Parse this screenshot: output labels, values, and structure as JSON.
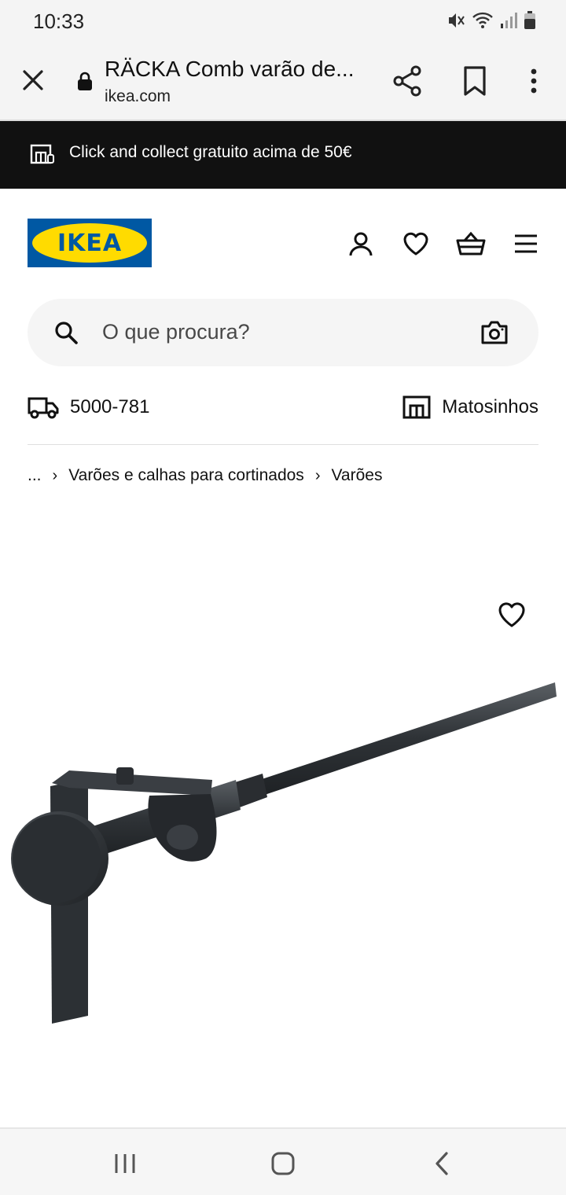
{
  "status_bar": {
    "time": "10:33"
  },
  "browser": {
    "page_title": "RÄCKA Comb varão de...",
    "domain": "ikea.com"
  },
  "promo": {
    "text": "Click and collect gratuito acima de 50€"
  },
  "header": {
    "logo_text": "IKEA"
  },
  "search": {
    "placeholder": "O que procura?"
  },
  "location": {
    "postal_code": "5000-781",
    "store": "Matosinhos"
  },
  "breadcrumb": {
    "ellipsis": "...",
    "separator": "›",
    "items": [
      "Varões e calhas para cortinados",
      "Varões"
    ]
  },
  "colors": {
    "ikea_blue": "#0058a3",
    "ikea_yellow": "#ffdb00",
    "promo_bg": "#111111"
  },
  "icons": [
    "close-icon",
    "lock-icon",
    "share-icon",
    "bookmark-icon",
    "more-icon",
    "store-icon",
    "user-icon",
    "heart-icon",
    "basket-icon",
    "hamburger-icon",
    "search-icon",
    "camera-icon",
    "truck-icon",
    "recents-icon",
    "home-icon",
    "back-icon"
  ]
}
